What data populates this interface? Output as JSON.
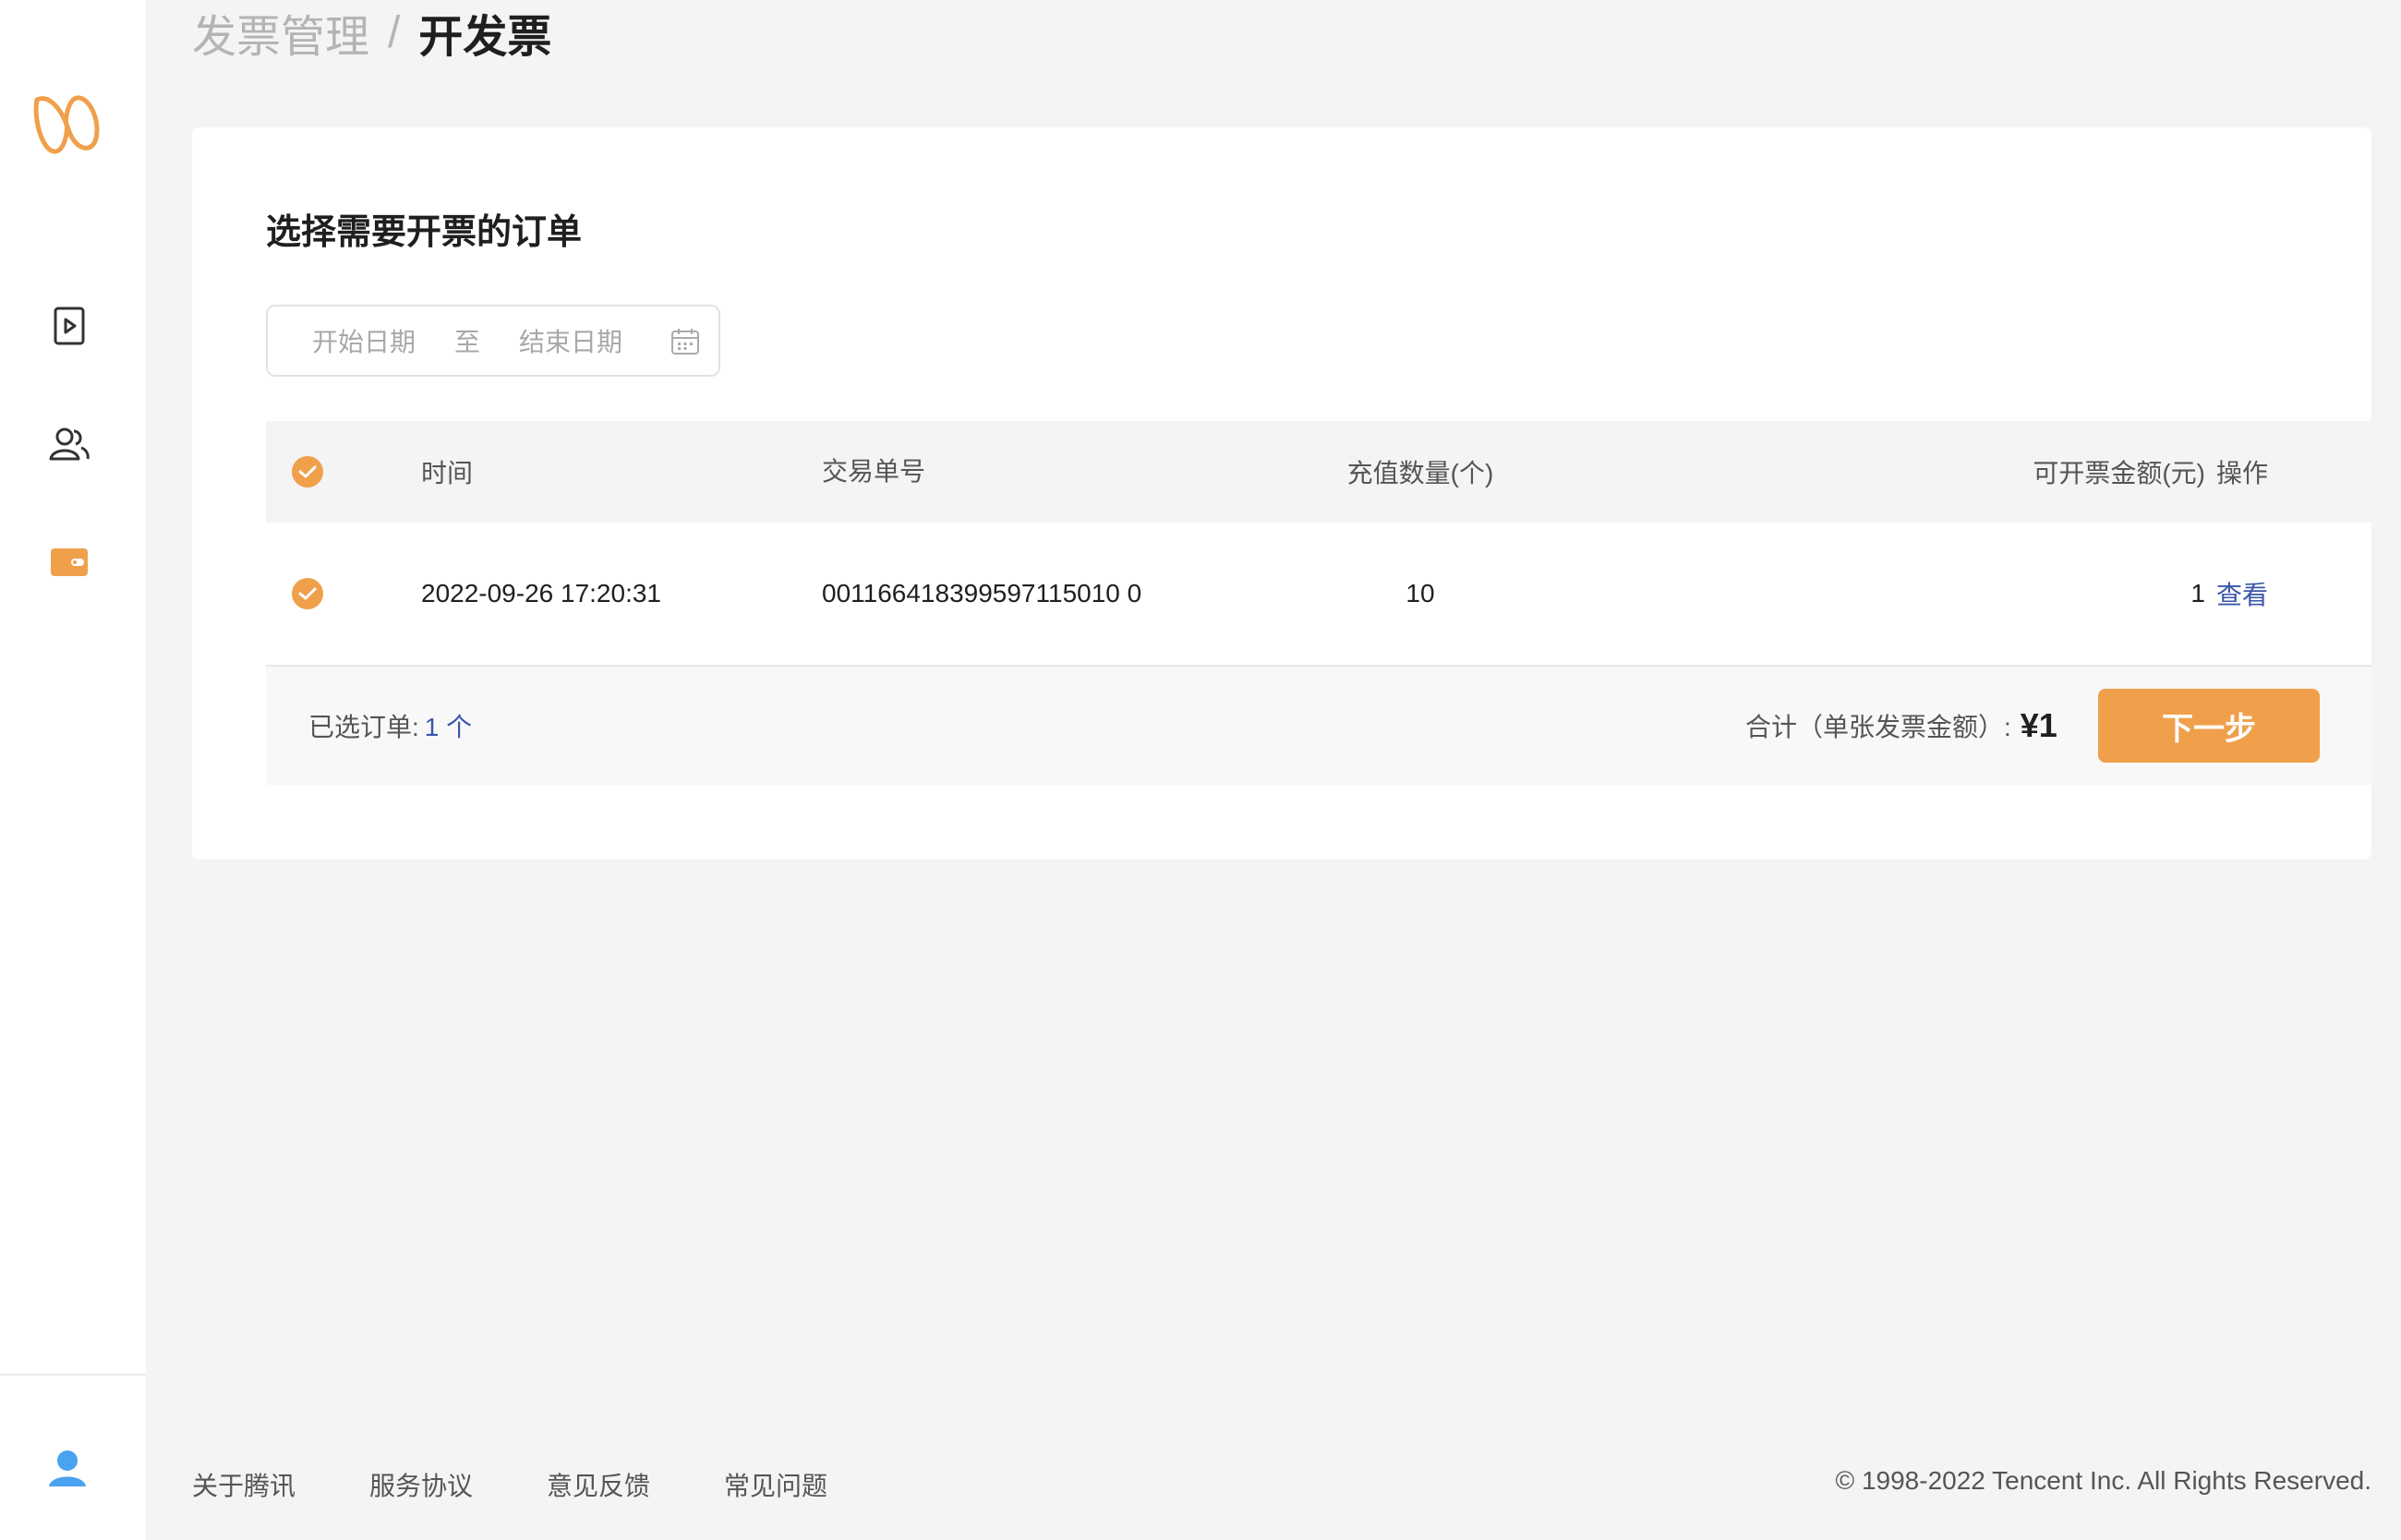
{
  "colors": {
    "accent": "#f0a04b",
    "link": "#3a57a8",
    "user_icon": "#4aa3f0"
  },
  "sidebar": {
    "logo": "brand-logo",
    "nav": [
      {
        "icon": "video-play-icon"
      },
      {
        "icon": "users-icon"
      },
      {
        "icon": "wallet-icon"
      }
    ],
    "bottom_icon": "user-profile-icon"
  },
  "breadcrumb": {
    "parent": "发票管理",
    "separator": "/",
    "current": "开发票"
  },
  "card": {
    "title": "选择需要开票的订单",
    "date_range": {
      "start_placeholder": "开始日期",
      "to": "至",
      "end_placeholder": "结束日期"
    },
    "table": {
      "headers": {
        "time": "时间",
        "order_no": "交易单号",
        "qty": "充值数量(个)",
        "amount": "可开票金额(元)",
        "op": "操作"
      },
      "rows": [
        {
          "checked": true,
          "time": "2022-09-26 17:20:31",
          "order_no": "001166418399597115010 0",
          "qty": "10",
          "amount": "1",
          "op": "查看"
        }
      ]
    },
    "summary": {
      "selected_label": "已选订单:",
      "selected_count": "1 个",
      "total_label": "合计（单张发票金额）:",
      "total_amount": "¥1",
      "next_button": "下一步"
    }
  },
  "footer": {
    "links": [
      "关于腾讯",
      "服务协议",
      "意见反馈",
      "常见问题"
    ],
    "copyright": "© 1998-2022 Tencent Inc. All Rights Reserved."
  }
}
